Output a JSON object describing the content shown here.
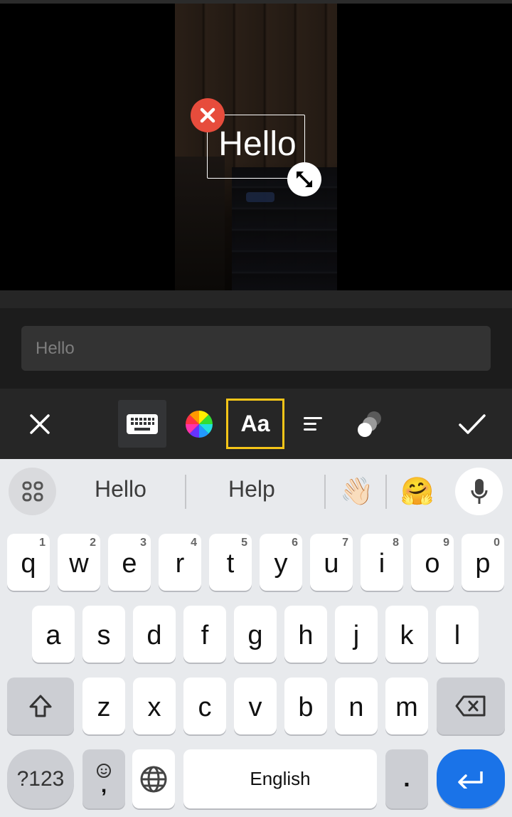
{
  "editor": {
    "sticker_text": "Hello",
    "delete_icon": "close-icon",
    "resize_icon": "resize-diagonal-icon"
  },
  "text_input": {
    "value": "Hello"
  },
  "toolbar": {
    "close_icon": "close-icon",
    "keyboard_icon": "keyboard-icon",
    "color_icon": "color-wheel-icon",
    "font_label": "Aa",
    "align_icon": "align-left-icon",
    "opacity_icon": "opacity-icon",
    "confirm_icon": "check-icon",
    "highlight_color": "#f5c518"
  },
  "keyboard": {
    "suggestions": [
      "Hello",
      "Help"
    ],
    "emoji_suggestions": [
      "👋🏻",
      "🤗"
    ],
    "row1": [
      {
        "key": "q",
        "hint": "1"
      },
      {
        "key": "w",
        "hint": "2"
      },
      {
        "key": "e",
        "hint": "3"
      },
      {
        "key": "r",
        "hint": "4"
      },
      {
        "key": "t",
        "hint": "5"
      },
      {
        "key": "y",
        "hint": "6"
      },
      {
        "key": "u",
        "hint": "7"
      },
      {
        "key": "i",
        "hint": "8"
      },
      {
        "key": "o",
        "hint": "9"
      },
      {
        "key": "p",
        "hint": "0"
      }
    ],
    "row2": [
      "a",
      "s",
      "d",
      "f",
      "g",
      "h",
      "j",
      "k",
      "l"
    ],
    "row3": [
      "z",
      "x",
      "c",
      "v",
      "b",
      "n",
      "m"
    ],
    "symbols_label": "?123",
    "comma_label": ",",
    "space_label": "English",
    "period_label": ".",
    "enter_color": "#1a73e8"
  }
}
